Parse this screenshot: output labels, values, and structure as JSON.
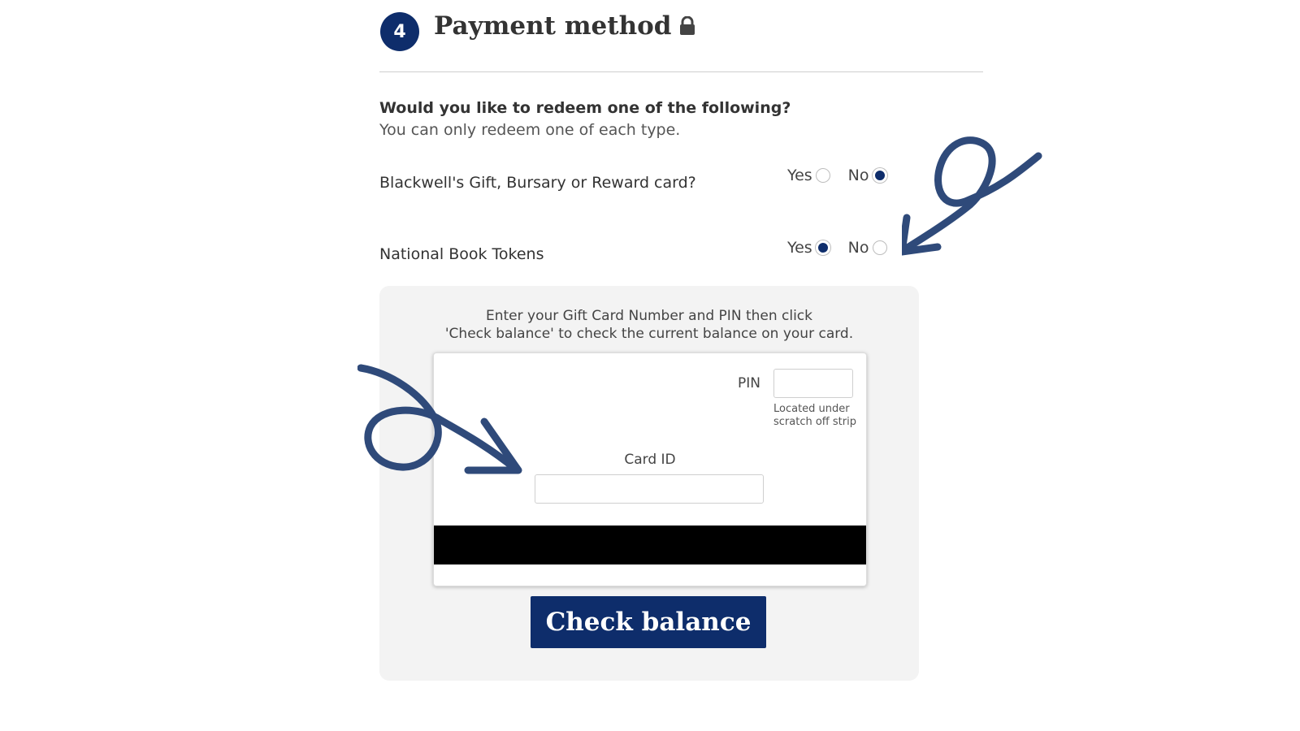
{
  "step": {
    "number": "4",
    "title": "Payment method",
    "icon": "lock-icon"
  },
  "redeem": {
    "heading": "Would you like to redeem one of the following?",
    "subheading": "You can only redeem one of each type.",
    "options": [
      {
        "label": "Blackwell's Gift, Bursary or Reward card?",
        "yes_label": "Yes",
        "no_label": "No",
        "selected": "No"
      },
      {
        "label": "National Book Tokens",
        "yes_label": "Yes",
        "no_label": "No",
        "selected": "Yes"
      }
    ]
  },
  "gift_card": {
    "instructions_line1": "Enter your Gift Card Number and PIN then click",
    "instructions_line2": "'Check balance' to check the current balance on your card.",
    "pin_label": "PIN",
    "pin_value": "",
    "pin_hint_line1": "Located under",
    "pin_hint_line2": "scratch off strip",
    "card_id_label": "Card ID",
    "card_id_value": "",
    "button_label": "Check balance"
  },
  "colors": {
    "brand_navy": "#0e2d6b",
    "annotation_arrow": "#2f4a7a",
    "panel_background": "#f3f3f3"
  }
}
